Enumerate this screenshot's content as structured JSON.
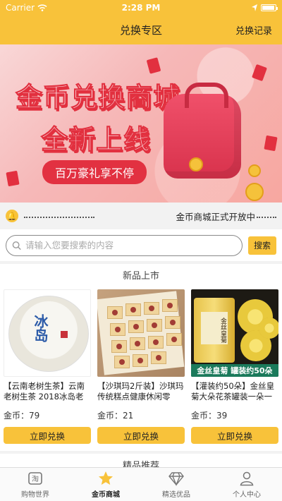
{
  "status": {
    "carrier": "Carrier",
    "time": "2:28 PM"
  },
  "nav": {
    "title": "兑换专区",
    "right_link": "兑换记录"
  },
  "banner": {
    "headline1": "金币兑换商城",
    "headline2": "全新上线",
    "pill": "百万豪礼享不停"
  },
  "notice": {
    "text": "金币商城正式开放中"
  },
  "search": {
    "placeholder": "请输入您要搜索的内容",
    "button": "搜索"
  },
  "sections": {
    "new_title": "新品上市",
    "recommend_title": "精品推荐"
  },
  "products": [
    {
      "name": "【云南老树生茶】云南老树生茶 2018冰岛老",
      "price_label": "金币：",
      "price": "79",
      "button": "立即兑换",
      "image_text": "冰岛"
    },
    {
      "name": "【沙琪玛2斤装】沙琪玛传统糕点健康休闲零",
      "price_label": "金币：",
      "price": "21",
      "button": "立即兑换"
    },
    {
      "name": "【灌装约50朵】金丝皇菊大朵花茶罐装一朵一",
      "price_label": "金币：",
      "price": "39",
      "button": "立即兑换",
      "image_text": "金丝皇菊",
      "ribbon": "金丝皇菊 罐装约50朵"
    }
  ],
  "tabs": [
    {
      "label": "购物世界",
      "icon": "shop-icon"
    },
    {
      "label": "金币商城",
      "icon": "star-icon",
      "active": true
    },
    {
      "label": "精选优品",
      "icon": "diamond-icon"
    },
    {
      "label": "个人中心",
      "icon": "person-icon"
    }
  ],
  "colors": {
    "accent": "#f8c23a",
    "banner_red": "#e2303f"
  }
}
